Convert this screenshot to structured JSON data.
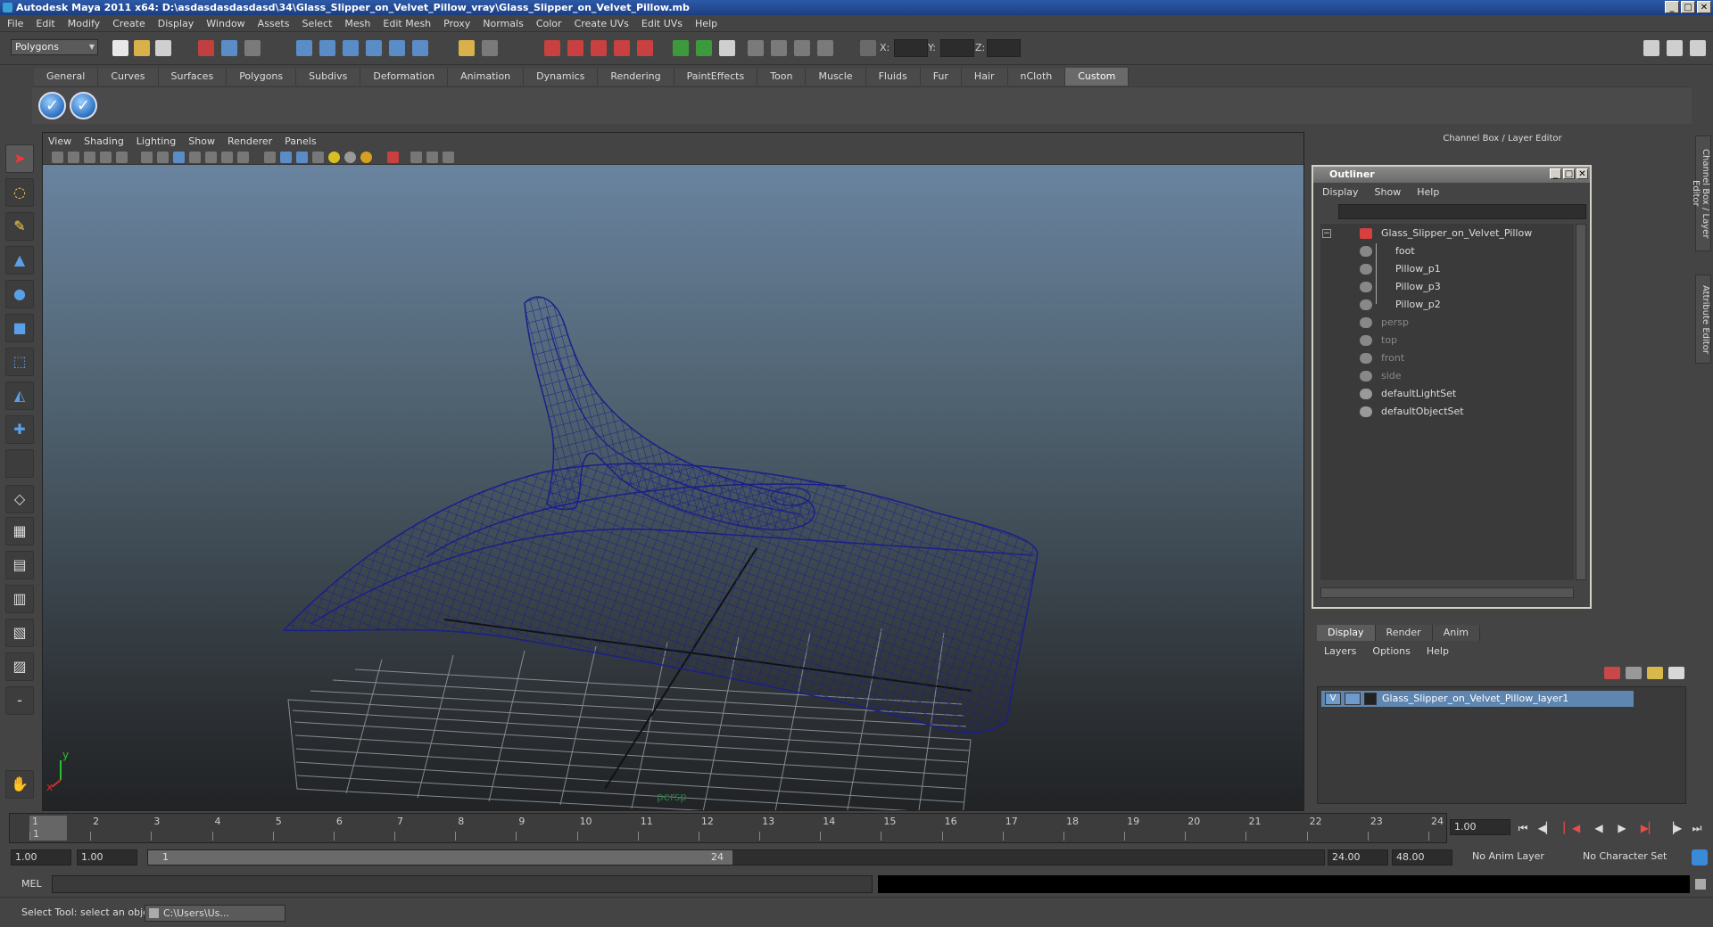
{
  "window": {
    "title": "Autodesk Maya 2011 x64: D:\\asdasdasdasdasd\\34\\Glass_Slipper_on_Velvet_Pillow_vray\\Glass_Slipper_on_Velvet_Pillow.mb"
  },
  "menubar": [
    "File",
    "Edit",
    "Modify",
    "Create",
    "Display",
    "Window",
    "Assets",
    "Select",
    "Mesh",
    "Edit Mesh",
    "Proxy",
    "Normals",
    "Color",
    "Create UVs",
    "Edit UVs",
    "Help"
  ],
  "status": {
    "mode": "Polygons",
    "x_label": "X:",
    "y_label": "Y:",
    "z_label": "Z:"
  },
  "shelf": {
    "tabs": [
      "General",
      "Curves",
      "Surfaces",
      "Polygons",
      "Subdivs",
      "Deformation",
      "Animation",
      "Dynamics",
      "Rendering",
      "PaintEffects",
      "Toon",
      "Muscle",
      "Fluids",
      "Fur",
      "Hair",
      "nCloth",
      "Custom"
    ],
    "active_tab": "Custom"
  },
  "viewport": {
    "menu": [
      "View",
      "Shading",
      "Lighting",
      "Show",
      "Renderer",
      "Panels"
    ],
    "camera": "persp",
    "axis_x": "x",
    "axis_y": "y"
  },
  "channel_box": {
    "title": "Channel Box / Layer Editor"
  },
  "outliner": {
    "title": "Outliner",
    "menu": [
      "Display",
      "Show",
      "Help"
    ],
    "items": [
      {
        "label": "Glass_Slipper_on_Velvet_Pillow",
        "indent": 0,
        "dim": false
      },
      {
        "label": "foot",
        "indent": 1,
        "dim": false
      },
      {
        "label": "Pillow_p1",
        "indent": 1,
        "dim": false
      },
      {
        "label": "Pillow_p3",
        "indent": 1,
        "dim": false
      },
      {
        "label": "Pillow_p2",
        "indent": 1,
        "dim": false
      },
      {
        "label": "persp",
        "indent": 0,
        "dim": true
      },
      {
        "label": "top",
        "indent": 0,
        "dim": true
      },
      {
        "label": "front",
        "indent": 0,
        "dim": true
      },
      {
        "label": "side",
        "indent": 0,
        "dim": true
      },
      {
        "label": "defaultLightSet",
        "indent": 0,
        "dim": false
      },
      {
        "label": "defaultObjectSet",
        "indent": 0,
        "dim": false
      }
    ]
  },
  "layer_editor": {
    "tabs": [
      "Display",
      "Render",
      "Anim"
    ],
    "menu": [
      "Layers",
      "Options",
      "Help"
    ],
    "visibility": "V",
    "layer": "Glass_Slipper_on_Velvet_Pillow_layer1"
  },
  "side_tabs": [
    "Channel Box / Layer Editor",
    "Attribute Editor"
  ],
  "timeline": {
    "ticks": [
      "1",
      "2",
      "3",
      "4",
      "5",
      "6",
      "7",
      "8",
      "9",
      "10",
      "11",
      "12",
      "13",
      "14",
      "15",
      "16",
      "17",
      "18",
      "19",
      "20",
      "21",
      "22",
      "23",
      "24"
    ],
    "current_marker": "1",
    "current_frame": "1.00"
  },
  "range": {
    "start": "1.00",
    "playback_start": "1.00",
    "slider_start": "1",
    "slider_end": "24",
    "playback_end": "24.00",
    "end": "48.00",
    "anim_layer": "No Anim Layer",
    "character_set": "No Character Set"
  },
  "command": {
    "label": "MEL"
  },
  "help": {
    "text": "Select Tool: select an object",
    "task": "C:\\Users\\Us..."
  }
}
